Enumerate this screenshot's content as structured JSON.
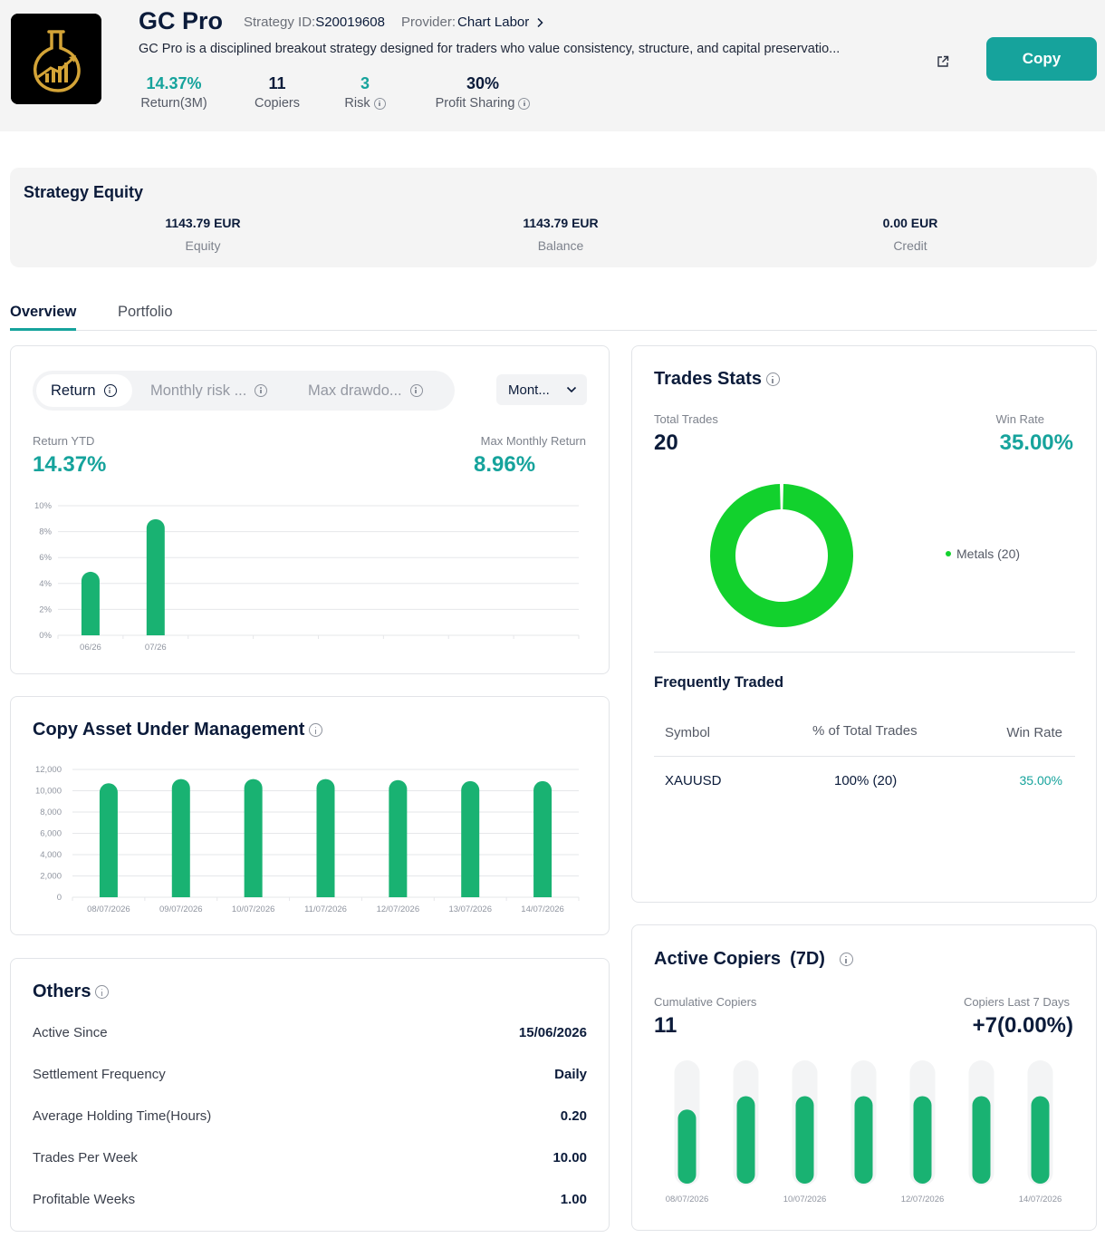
{
  "header": {
    "title": "GC Pro",
    "strategy_id_label": "Strategy ID:",
    "strategy_id": "S20019608",
    "provider_label": "Provider:",
    "provider": "Chart Labor",
    "description": "GC Pro is a disciplined breakout strategy designed for traders who value consistency, structure, and capital preservatio...",
    "copy_button": "Copy",
    "stats": [
      {
        "value": "14.37%",
        "label": "Return(3M)",
        "color": "#16a39c"
      },
      {
        "value": "11",
        "label": "Copiers"
      },
      {
        "value": "3",
        "label": "Risk",
        "color": "#16a39c"
      },
      {
        "value": "30%",
        "label": "Profit Sharing"
      }
    ]
  },
  "equity": {
    "title": "Strategy Equity",
    "items": [
      {
        "value": "1143.79 EUR",
        "label": "Equity"
      },
      {
        "value": "1143.79 EUR",
        "label": "Balance"
      },
      {
        "value": "0.00 EUR",
        "label": "Credit"
      }
    ]
  },
  "tabs": [
    "Overview",
    "Portfolio"
  ],
  "return_card": {
    "segments": [
      "Return",
      "Monthly risk ...",
      "Max drawdo..."
    ],
    "dropdown": "Mont...",
    "return_ytd_label": "Return YTD",
    "return_ytd": "14.37%",
    "max_monthly_label": "Max Monthly Return",
    "max_monthly": "8.96%"
  },
  "aum_card": {
    "title": "Copy Asset Under Management"
  },
  "others": {
    "title": "Others",
    "rows": [
      {
        "key": "Active Since",
        "value": "15/06/2026"
      },
      {
        "key": "Settlement Frequency",
        "value": "Daily"
      },
      {
        "key": "Average Holding Time(Hours)",
        "value": "0.20"
      },
      {
        "key": "Trades Per Week",
        "value": "10.00"
      },
      {
        "key": "Profitable Weeks",
        "value": "1.00"
      }
    ]
  },
  "trades_stats": {
    "title": "Trades Stats",
    "total_trades_label": "Total Trades",
    "total_trades": "20",
    "win_rate_label": "Win Rate",
    "win_rate": "35.00%",
    "legend": "Metals (20)",
    "frequently_traded_title": "Frequently Traded",
    "columns": [
      "Symbol",
      "% of Total Trades",
      "Win Rate"
    ],
    "rows": [
      {
        "symbol": "XAUUSD",
        "pct": "100% (20)",
        "win_rate": "35.00%"
      }
    ]
  },
  "active_copiers": {
    "title": "Active Copiers",
    "period": "(7D)",
    "cumulative_label": "Cumulative Copiers",
    "cumulative": "11",
    "last7_label": "Copiers Last 7 Days",
    "last7": "+7(0.00%)"
  },
  "colors": {
    "accent": "#16a39c",
    "bar_green": "#19b272",
    "donut_green": "#12d12d",
    "navy": "#0b1b3a"
  },
  "chart_data": [
    {
      "type": "bar",
      "title": "",
      "categories": [
        "06/26",
        "07/26"
      ],
      "values": [
        4.9,
        8.96
      ],
      "ylim": [
        0,
        10
      ],
      "yticks": [
        "0%",
        "2%",
        "4%",
        "6%",
        "8%",
        "10%"
      ],
      "grid": true
    },
    {
      "type": "bar",
      "title": "Copy Asset Under Management",
      "categories": [
        "08/07/2026",
        "09/07/2026",
        "10/07/2026",
        "11/07/2026",
        "12/07/2026",
        "13/07/2026",
        "14/07/2026"
      ],
      "values": [
        10700,
        11100,
        11100,
        11100,
        11000,
        10900,
        10900
      ],
      "ylim": [
        0,
        12000
      ],
      "yticks": [
        "0",
        "2,000",
        "4,000",
        "6,000",
        "8,000",
        "10,000",
        "12,000"
      ],
      "grid": true
    },
    {
      "type": "pie",
      "title": "",
      "labels": [
        "Metals"
      ],
      "values": [
        20
      ],
      "legend": "right"
    },
    {
      "type": "bar",
      "title": "",
      "categories": [
        "08/07/2026",
        "09/07/2026",
        "10/07/2026",
        "11/07/2026",
        "12/07/2026",
        "13/07/2026",
        "14/07/2026"
      ],
      "tick_labels": [
        "08/07/2026",
        "",
        "10/07/2026",
        "",
        "12/07/2026",
        "",
        "14/07/2026"
      ],
      "values": [
        0.61,
        0.72,
        0.72,
        0.72,
        0.72,
        0.72,
        0.72
      ],
      "ylim": [
        0,
        1
      ]
    }
  ]
}
